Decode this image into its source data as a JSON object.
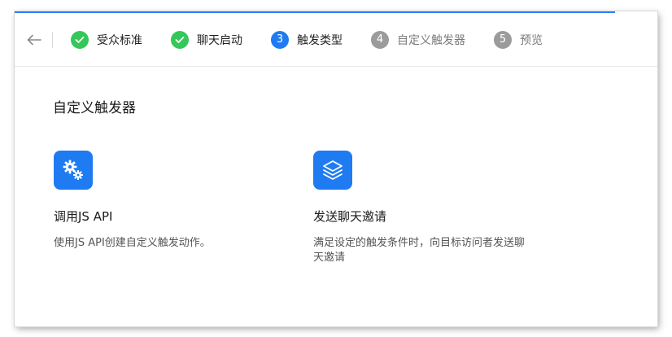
{
  "stepper": {
    "steps": [
      {
        "number": "1",
        "label": "受众标准",
        "state": "done"
      },
      {
        "number": "2",
        "label": "聊天启动",
        "state": "done"
      },
      {
        "number": "3",
        "label": "触发类型",
        "state": "active"
      },
      {
        "number": "4",
        "label": "自定义触发器",
        "state": "todo"
      },
      {
        "number": "5",
        "label": "预览",
        "state": "todo"
      }
    ]
  },
  "main": {
    "title": "自定义触发器",
    "cards": [
      {
        "icon": "gears-icon",
        "title": "调用JS API",
        "description": "使用JS API创建自定义触发动作。"
      },
      {
        "icon": "stack-layers-icon",
        "title": "发送聊天邀请",
        "description": "满足设定的触发条件时，向目标访问者发送聊天邀请"
      }
    ]
  },
  "colors": {
    "accent": "#1f7bf2",
    "done": "#34c759",
    "todo": "#9b9b9b"
  }
}
